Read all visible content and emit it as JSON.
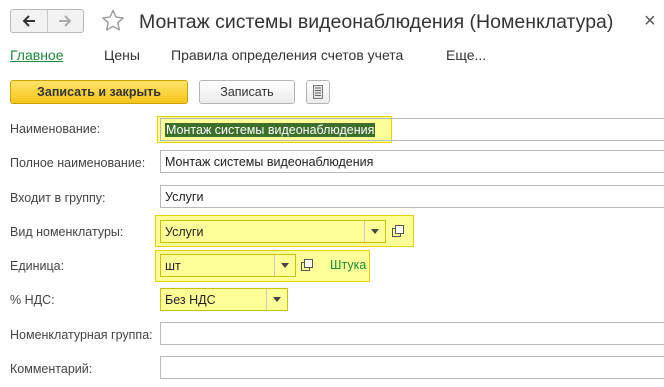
{
  "window": {
    "title": "Монтаж системы видеонаблюдения (Номенклатура)",
    "close_glyph": "×"
  },
  "tabs": [
    {
      "label": "Главное",
      "active": true
    },
    {
      "label": "Цены",
      "active": false
    },
    {
      "label": "Правила определения счетов учета",
      "active": false
    },
    {
      "label": "Еще...",
      "active": false
    }
  ],
  "toolbar": {
    "save_close_label": "Записать и закрыть",
    "save_label": "Записать"
  },
  "form": {
    "name": {
      "label": "Наименование:",
      "value": "Монтаж системы видеонаблюдения"
    },
    "full_name": {
      "label": "Полное наименование:",
      "value": "Монтаж системы видеонаблюдения"
    },
    "group": {
      "label": "Входит в группу:",
      "value": "Услуги"
    },
    "kind": {
      "label": "Вид номенклатуры:",
      "value": "Услуги"
    },
    "unit": {
      "label": "Единица:",
      "value": "шт",
      "link": "Штука"
    },
    "vat": {
      "label": "% НДС:",
      "value": "Без НДС"
    },
    "nomenclature_group": {
      "label": "Номенклатурная группа:",
      "value": ""
    },
    "comment": {
      "label": "Комментарий:",
      "value": ""
    }
  },
  "colors": {
    "accent_green": "#1a8a3a",
    "primary_button": "#f5c518",
    "highlight": "#ffff99"
  }
}
